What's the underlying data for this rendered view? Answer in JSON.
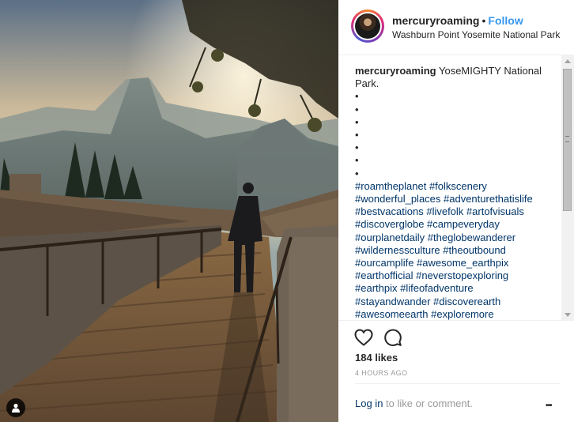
{
  "post": {
    "username": "mercuryroaming",
    "separator": "•",
    "follow_label": "Follow",
    "location": "Washburn Point Yosemite National Park"
  },
  "caption": {
    "username": "mercuryroaming",
    "text_line1": "YoseMIGHTY National",
    "text_line2": "Park.",
    "bullets": [
      "•",
      "•",
      "•",
      "•",
      "•",
      "•",
      "•",
      "•"
    ],
    "hashtags": [
      "#roamtheplanet #folkscenery",
      "#wonderful_places #adventurethatislife",
      "#bestvacations #livefolk #artofvisuals",
      "#discoverglobe #campeveryday",
      "#ourplanetdaily #theglobewanderer",
      "#wildernessculture #theoutbound",
      "#ourcamplife #awesome_earthpix",
      "#earthofficial #neverstopexploring",
      "#earthpix #lifeofadventure",
      "#stayandwander #discoverearth",
      "#awesomeearth #exploremore"
    ]
  },
  "stats": {
    "likes": "184 likes",
    "time": "4 HOURS AGO"
  },
  "comment_bar": {
    "login_label": "Log in",
    "login_suffix": " to like or comment.",
    "more_label": "•••"
  },
  "icons": {
    "like": "heart-icon",
    "comment": "comment-icon",
    "tagged_user": "person-icon"
  },
  "colors": {
    "follow": "#3897f0",
    "hashtag": "#003569",
    "muted": "#999999"
  }
}
